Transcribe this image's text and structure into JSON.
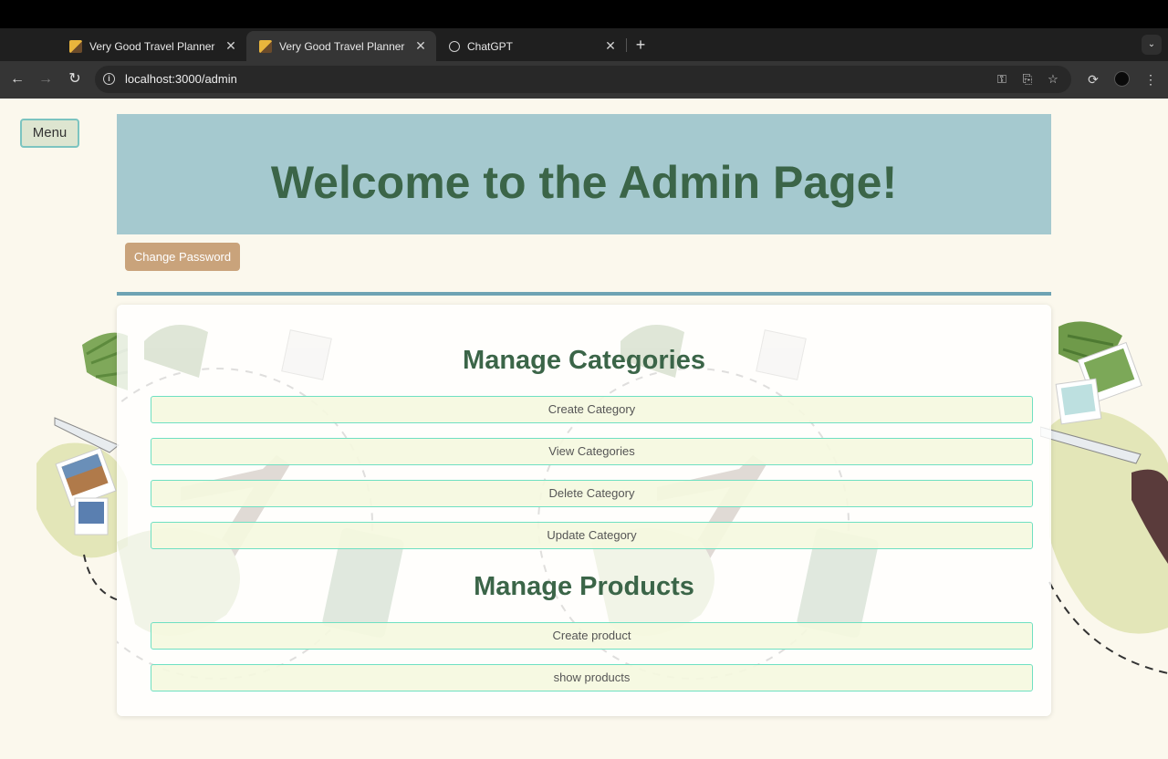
{
  "browser": {
    "tabs": [
      {
        "title": "Very Good Travel Planner",
        "active": false
      },
      {
        "title": "Very Good Travel Planner",
        "active": true
      },
      {
        "title": "ChatGPT",
        "active": false
      }
    ],
    "url": "localhost:3000/admin"
  },
  "page": {
    "menu_label": "Menu",
    "heading": "Welcome to the Admin Page!",
    "change_password_label": "Change Password",
    "categories": {
      "title": "Manage Categories",
      "buttons": [
        "Create Category",
        "View Categories",
        "Delete Category",
        "Update Category"
      ]
    },
    "products": {
      "title": "Manage Products",
      "buttons": [
        "Create product",
        "show products"
      ]
    }
  },
  "colors": {
    "banner_bg": "#a5c9cf",
    "heading_green": "#3b6548",
    "change_password_bg": "#c9a37b",
    "button_border": "#6fe0c2",
    "page_bg": "#fbf8ed"
  }
}
